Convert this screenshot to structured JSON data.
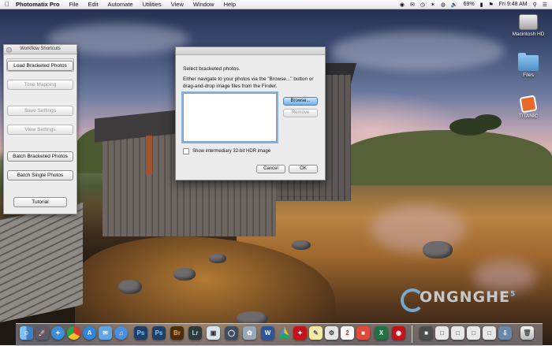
{
  "menubar": {
    "app_name": "Photomatix Pro",
    "items": [
      "File",
      "Edit",
      "Automate",
      "Utilities",
      "View",
      "Window",
      "Help"
    ],
    "battery": "69%",
    "clock": "Fri 9:48 AM"
  },
  "desktop_icons": [
    "Macintosh HD",
    "Files",
    "TITANIC"
  ],
  "palette": {
    "title": "Workflow Shortcuts",
    "buttons": {
      "load": "Load Bracketed Photos",
      "tone": "Tone Mapping",
      "save": "Save Settings",
      "view": "View Settings",
      "batch_bracketed": "Batch Bracketed Photos",
      "batch_single": "Batch Single Photos",
      "tutorial": "Tutorial"
    }
  },
  "dialog": {
    "title": "Select bracketed photos.",
    "instructions": "Either navigate to your photos via the \"Browse...\" button or drag-and-drop image files from the Finder.",
    "browse": "Browse...",
    "remove": "Remove",
    "checkbox_label": "Show intermediary 32-bit HDR image",
    "cancel": "Cancel",
    "ok": "OK"
  },
  "watermark": "ONGNGHE",
  "watermark_sup": "5",
  "dock": {
    "icons": [
      "finder-icon",
      "launchpad-icon",
      "safari-icon",
      "chrome-icon",
      "appstore-icon",
      "mail-icon",
      "itunes-icon",
      "photoshop-icon",
      "photoshop-icon",
      "bridge-icon",
      "lightroom-icon",
      "preview-icon",
      "photomatix-icon",
      "photos-icon",
      "word-icon",
      "drive-icon",
      "excel-icon",
      "acrobat-icon",
      "notes-icon",
      "calendar-icon",
      "system-prefs-icon",
      "creative-cloud-icon",
      "downloads-icon",
      "trash-icon"
    ],
    "colors": {
      "ps": "#1f3f68",
      "br": "#4a2d0c",
      "lr": "#2d3a3a",
      "word": "#2b579a",
      "excel": "#207245",
      "acrobat": "#c3121b"
    }
  }
}
